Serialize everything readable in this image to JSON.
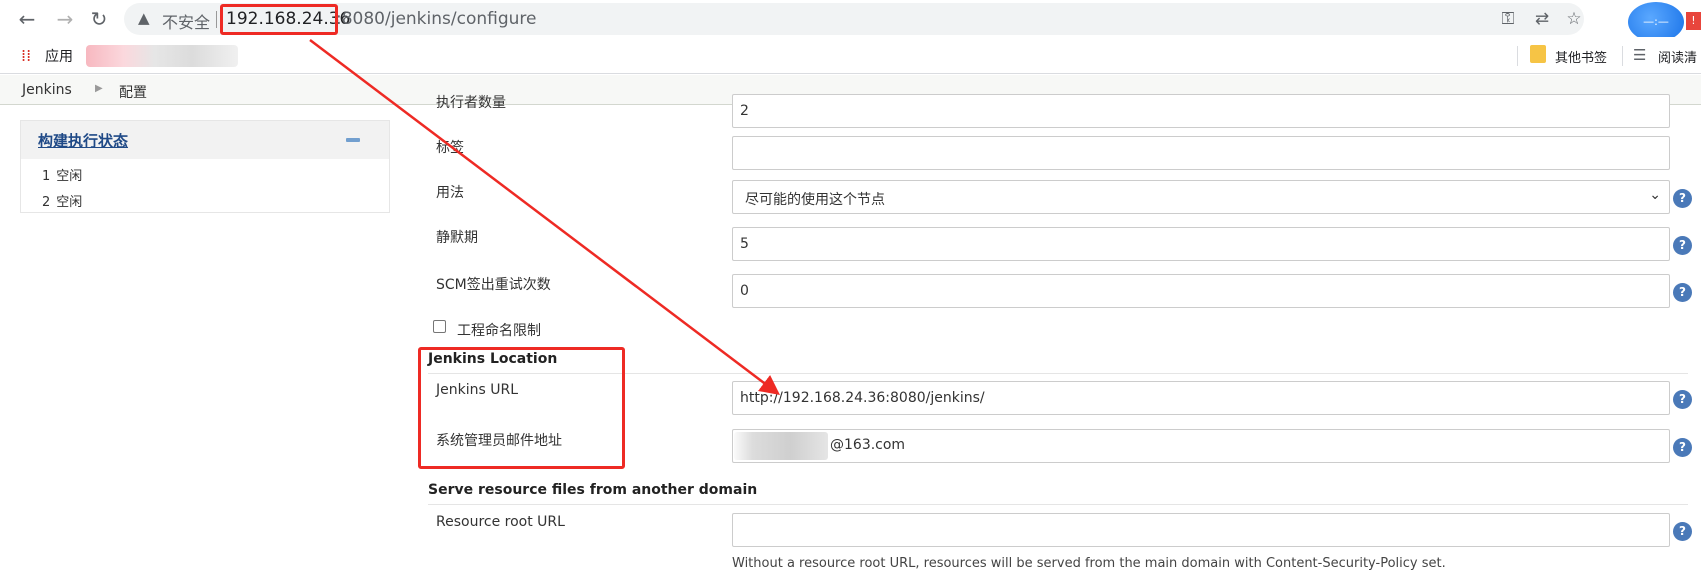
{
  "browser": {
    "not_secure_label": "不安全",
    "url_host": "192.168.24.36",
    "url_path": ":8080/jenkins/configure",
    "avatar_text": "—:—",
    "bookmarks": {
      "apps_label": "应用",
      "other_label": "其他书签",
      "reading_label": "阅读清"
    }
  },
  "breadcrumb": {
    "items": [
      "Jenkins",
      "配置"
    ]
  },
  "executors_panel": {
    "title": "构建执行状态",
    "executors": [
      {
        "num": "1",
        "status": "空闲"
      },
      {
        "num": "2",
        "status": "空闲"
      }
    ]
  },
  "form": {
    "executors_label": "执行者数量",
    "executors_value": "2",
    "labels_label": "标签",
    "labels_value": "",
    "usage_label": "用法",
    "usage_value": "尽可能的使用这个节点",
    "quiet_period_label": "静默期",
    "quiet_period_value": "5",
    "scm_retry_label": "SCM签出重试次数",
    "scm_retry_value": "0",
    "restrict_naming_label": "工程命名限制",
    "location_section_title": "Jenkins Location",
    "jenkins_url_label": "Jenkins URL",
    "jenkins_url_value": "http://192.168.24.36:8080/jenkins/",
    "admin_email_label": "系统管理员邮件地址",
    "admin_email_suffix": "@163.com",
    "resource_section_title": "Serve resource files from another domain",
    "resource_root_label": "Resource root URL",
    "resource_root_value": "",
    "resource_root_hint": "Without a resource root URL, resources will be served from the main domain with Content-Security-Policy set."
  },
  "icons": {
    "back": "arrow-left-icon",
    "forward": "arrow-right-icon",
    "reload": "reload-icon",
    "help": "help-icon",
    "annotation_color": "#ee2a24"
  }
}
